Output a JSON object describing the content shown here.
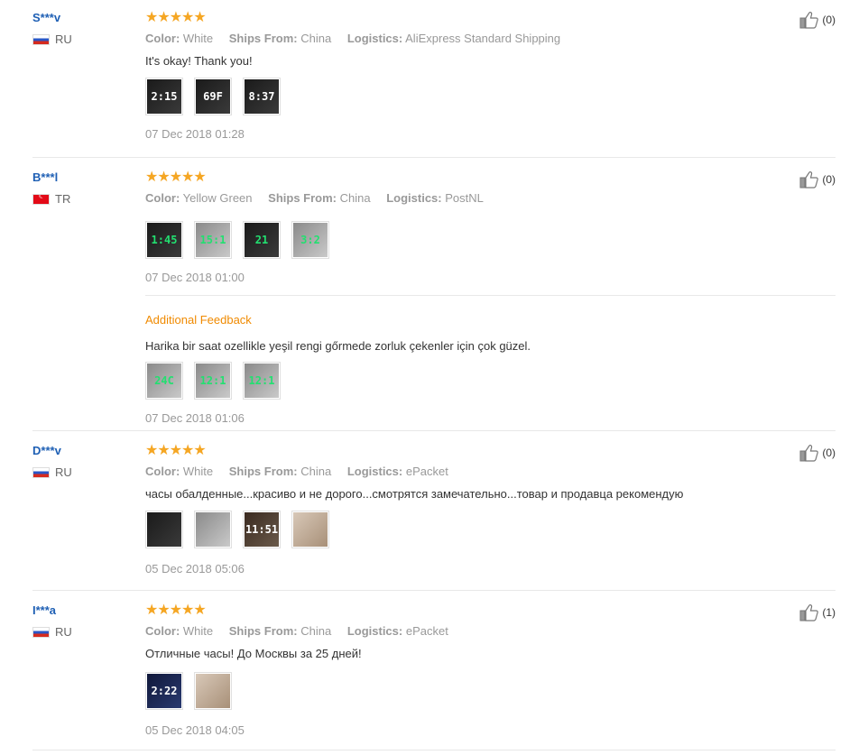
{
  "labels": {
    "color": "Color:",
    "ships_from": "Ships From:",
    "logistics": "Logistics:",
    "additional_feedback": "Additional Feedback"
  },
  "stars": "★★★★★",
  "reviews": [
    {
      "user": "S***v",
      "country": "RU",
      "color": "White",
      "ships_from": "China",
      "logistics": "AliExpress Standard Shipping",
      "text": "It's okay! Thank you!",
      "date": "07 Dec 2018 01:28",
      "likes": "(0)"
    },
    {
      "user": "B***l",
      "country": "TR",
      "color": "Yellow Green",
      "ships_from": "China",
      "logistics": "PostNL",
      "text": "",
      "date": "07 Dec 2018 01:00",
      "likes": "(0)",
      "additional_text": "Harika bir saat ozellikle yeşil rengi gőrmede zorluk çekenler için çok güzel.",
      "additional_date": "07 Dec 2018 01:06"
    },
    {
      "user": "D***v",
      "country": "RU",
      "color": "White",
      "ships_from": "China",
      "logistics": "ePacket",
      "text": "часы обалденные...красиво и не дорого...смотрятся замечательно...товар и продавца рекомендую",
      "date": "05 Dec 2018 05:06",
      "likes": "(0)"
    },
    {
      "user": "I***a",
      "country": "RU",
      "color": "White",
      "ships_from": "China",
      "logistics": "ePacket",
      "text": "Отличные часы! До Москвы за 25 дней!",
      "date": "05 Dec 2018 04:05",
      "likes": "(1)"
    }
  ],
  "colors": {
    "username": "#1e5fb4",
    "star": "#f5a623",
    "additional_feedback": "#f08a00",
    "muted": "#999999"
  }
}
